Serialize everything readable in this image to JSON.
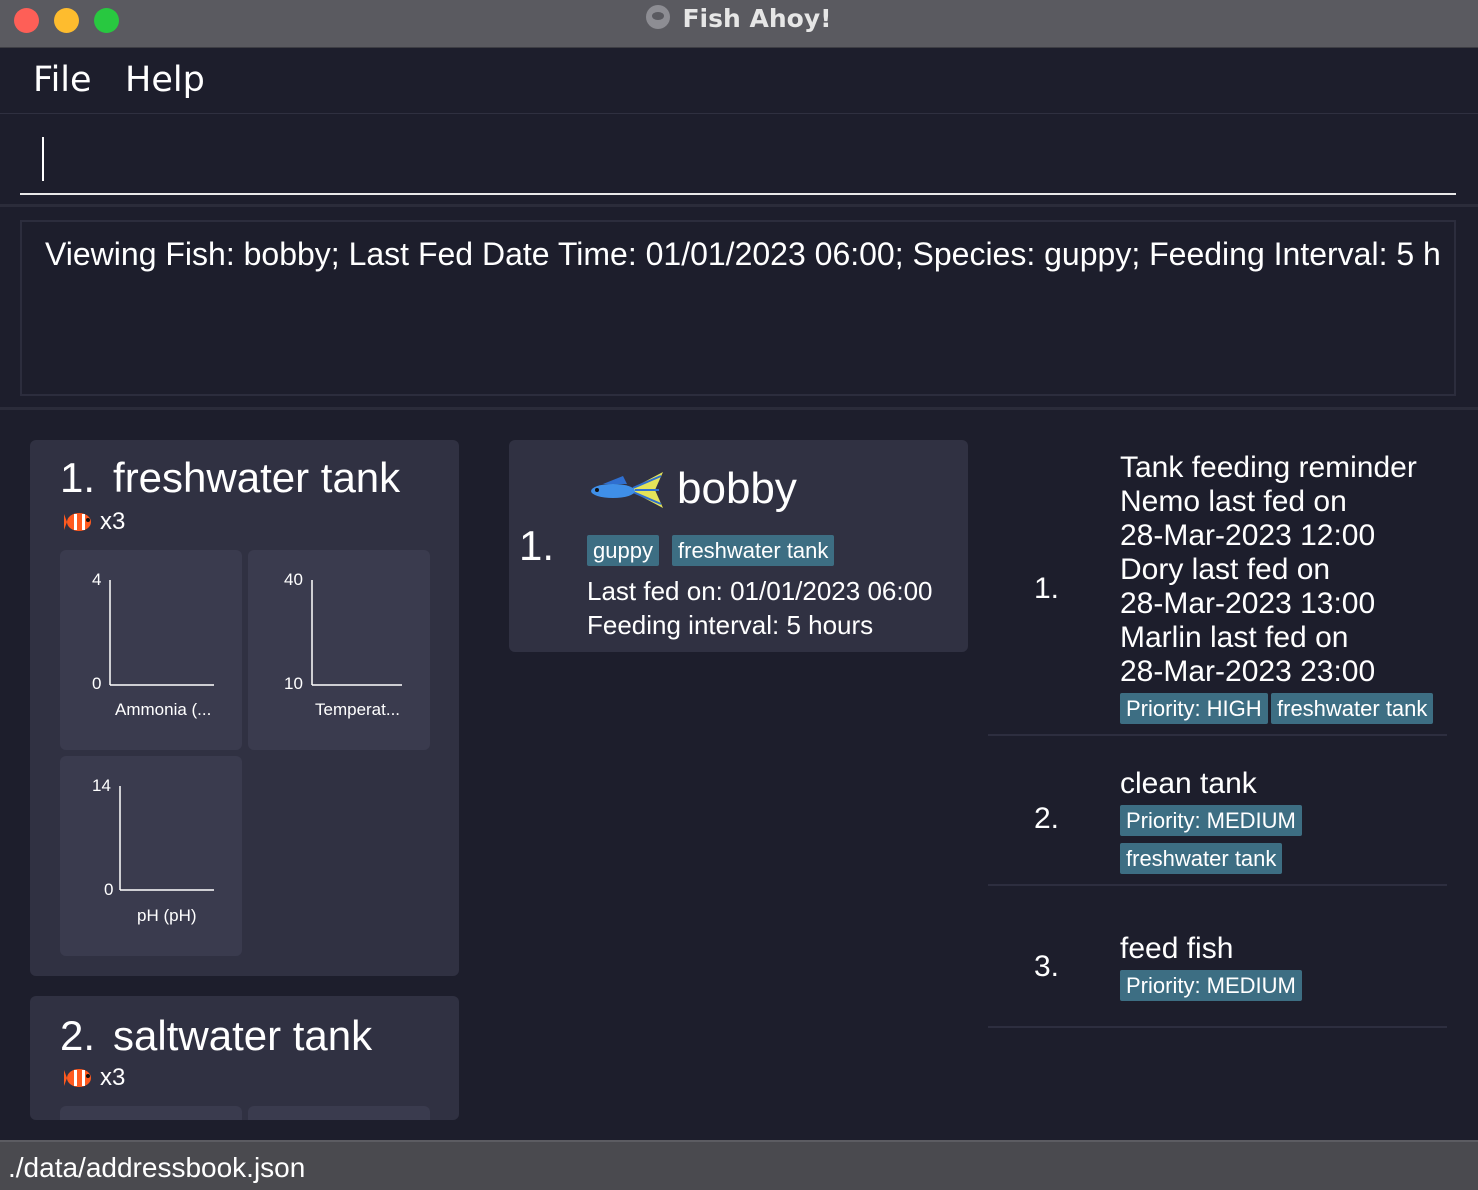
{
  "window": {
    "title": "Fish Ahoy!"
  },
  "menu": {
    "file": "File",
    "help": "Help"
  },
  "command": {
    "value": ""
  },
  "result": {
    "text": "Viewing Fish: bobby; Last Fed Date Time: 01/01/2023 06:00; Species: guppy; Feeding Interval: 5 h"
  },
  "tanks": [
    {
      "index": "1.",
      "name": "freshwater tank",
      "fish_count": "x3",
      "charts": [
        {
          "ymax": "4",
          "ymin": "0",
          "label": "Ammonia (..."
        },
        {
          "ymax": "40",
          "ymin": "10",
          "label": "Temperat..."
        },
        {
          "ymax": "14",
          "ymin": "0",
          "label": "pH (pH)"
        }
      ]
    },
    {
      "index": "2.",
      "name": "saltwater tank",
      "fish_count": "x3"
    }
  ],
  "fish": [
    {
      "index": "1.",
      "name": "bobby",
      "tags": [
        "guppy",
        "freshwater tank"
      ],
      "last_fed": "Last fed on: 01/01/2023 06:00",
      "interval": "Feeding interval: 5 hours"
    }
  ],
  "tasks": [
    {
      "index": "1.",
      "lines": [
        "Tank feeding reminder",
        "Nemo last fed on",
        "28-Mar-2023 12:00",
        "Dory last fed on",
        "28-Mar-2023 13:00",
        "Marlin last fed on",
        "28-Mar-2023 23:00"
      ],
      "priority": "Priority: HIGH",
      "tank": "freshwater tank"
    },
    {
      "index": "2.",
      "lines": [
        "clean tank"
      ],
      "priority": "Priority: MEDIUM",
      "tank": "freshwater tank"
    },
    {
      "index": "3.",
      "lines": [
        "feed fish"
      ],
      "priority": "Priority: MEDIUM"
    }
  ],
  "status": {
    "path": "./data/addressbook.json"
  },
  "colors": {
    "background": "#1d1e2c",
    "card": "#303142",
    "tag": "#3d6e83",
    "statusbar": "#4a4a4f"
  }
}
